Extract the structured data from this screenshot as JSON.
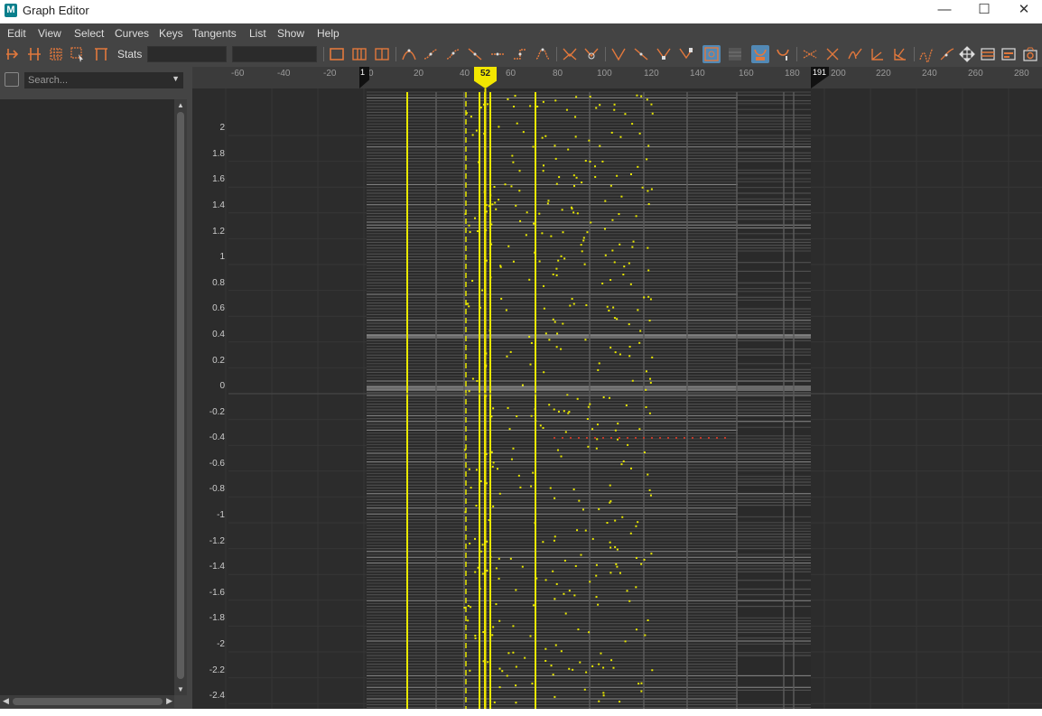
{
  "window": {
    "title": "Graph Editor",
    "logo": "M"
  },
  "controls": {
    "minimize": "—",
    "maximize": "☐",
    "close": "✕"
  },
  "menu": [
    "Edit",
    "View",
    "Select",
    "Curves",
    "Keys",
    "Tangents",
    "List",
    "Show",
    "Help"
  ],
  "toolbar": {
    "stats_label": "Stats",
    "stats_value1": "",
    "stats_value2": ""
  },
  "outliner": {
    "search_placeholder": "Search..."
  },
  "timeline": {
    "ticks": [
      "-60",
      "-40",
      "-20",
      "0",
      "20",
      "40",
      "60",
      "80",
      "100",
      "120",
      "140",
      "160",
      "180",
      "200",
      "220",
      "240",
      "260",
      "280"
    ],
    "start_frame": "1",
    "end_frame": "191",
    "current_frame": "52"
  },
  "y_axis": [
    "2",
    "1.8",
    "1.6",
    "1.4",
    "1.2",
    "1",
    "0.8",
    "0.6",
    "0.4",
    "0.2",
    "0",
    "-0.2",
    "-0.4",
    "-0.6",
    "-0.8",
    "-1",
    "-1.2",
    "-1.4",
    "-1.6",
    "-1.8",
    "-2",
    "-2.2",
    "-2.4"
  ],
  "colors": {
    "accent": "#5289b5",
    "key_yellow": "#e8e800",
    "current_time": "#f2e600",
    "icon_orange": "#e2783c",
    "key_red": "#c23a2a"
  }
}
